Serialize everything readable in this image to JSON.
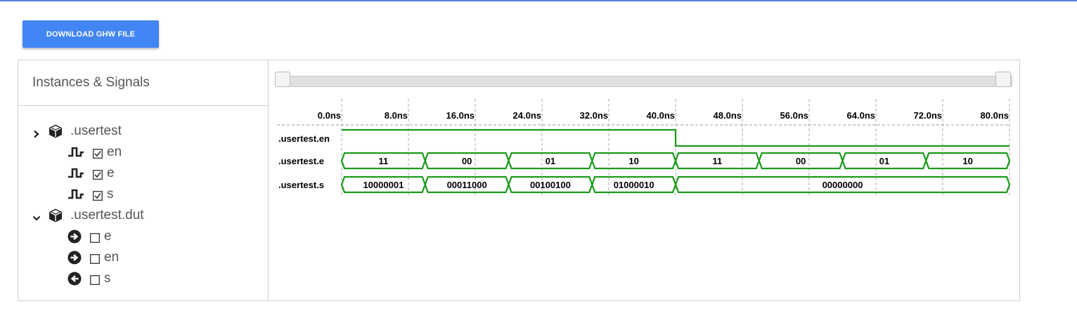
{
  "header": {
    "download_label": "DOWNLOAD GHW FILE"
  },
  "sidebar": {
    "title": "Instances & Signals",
    "instances": [
      {
        "name": ".usertest",
        "expanded": true,
        "signals": [
          {
            "name": "en",
            "checked": true,
            "icon": "signal-wave-icon"
          },
          {
            "name": "e",
            "checked": true,
            "icon": "signal-wave-icon"
          },
          {
            "name": "s",
            "checked": true,
            "icon": "signal-wave-icon"
          }
        ]
      },
      {
        "name": ".usertest.dut",
        "expanded": true,
        "signals": [
          {
            "name": "e",
            "checked": false,
            "icon": "port-in-icon"
          },
          {
            "name": "en",
            "checked": false,
            "icon": "port-in-icon"
          },
          {
            "name": "s",
            "checked": false,
            "icon": "port-out-icon"
          }
        ]
      }
    ]
  },
  "waveform": {
    "time_ticks": [
      "0.0ns",
      "8.0ns",
      "16.0ns",
      "24.0ns",
      "32.0ns",
      "40.0ns",
      "48.0ns",
      "56.0ns",
      "64.0ns",
      "72.0ns",
      "80.0ns"
    ],
    "time_range_ns": [
      0,
      80
    ],
    "colors": {
      "wave": "#1a9a1a",
      "grid": "#aaaaaa",
      "axis": "#999999",
      "text": "#000000"
    },
    "signals": [
      {
        "name": ".usertest.en",
        "kind": "bit",
        "transitions": [
          {
            "t": 0,
            "v": 1
          },
          {
            "t": 40,
            "v": 0
          }
        ]
      },
      {
        "name": ".usertest.e",
        "kind": "bus",
        "segments": [
          {
            "start": 0,
            "end": 10,
            "label": "11"
          },
          {
            "start": 10,
            "end": 20,
            "label": "00"
          },
          {
            "start": 20,
            "end": 30,
            "label": "01"
          },
          {
            "start": 30,
            "end": 40,
            "label": "10"
          },
          {
            "start": 40,
            "end": 50,
            "label": "11"
          },
          {
            "start": 50,
            "end": 60,
            "label": "00"
          },
          {
            "start": 60,
            "end": 70,
            "label": "01"
          },
          {
            "start": 70,
            "end": 80,
            "label": "10"
          }
        ]
      },
      {
        "name": ".usertest.s",
        "kind": "bus",
        "segments": [
          {
            "start": 0,
            "end": 10,
            "label": "10000001"
          },
          {
            "start": 10,
            "end": 20,
            "label": "00011000"
          },
          {
            "start": 20,
            "end": 30,
            "label": "00100100"
          },
          {
            "start": 30,
            "end": 40,
            "label": "01000010"
          },
          {
            "start": 40,
            "end": 80,
            "label": "00000000"
          }
        ]
      }
    ]
  }
}
